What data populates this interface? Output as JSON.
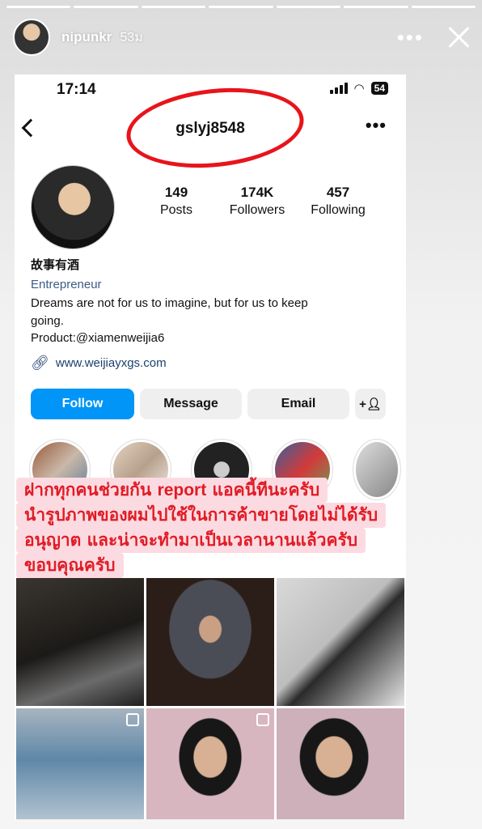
{
  "story": {
    "username": "nipunkr",
    "time": "53ม",
    "progress_count": 7
  },
  "status_bar": {
    "time": "17:14",
    "battery": "54"
  },
  "profile": {
    "username": "gslyj8548",
    "stats": [
      {
        "value": "149",
        "label": "Posts"
      },
      {
        "value": "174K",
        "label": "Followers"
      },
      {
        "value": "457",
        "label": "Following"
      }
    ],
    "name": "故事有酒",
    "category": "Entrepreneur",
    "bio_line1": "Dreams are not for us to imagine, but for us to keep",
    "bio_line2": "going.",
    "product": "Product:@xiamenweijia6",
    "link": "www.weijiayxgs.com"
  },
  "buttons": {
    "follow": "Follow",
    "message": "Message",
    "email": "Email"
  },
  "caption": {
    "line1_pre": "ฝากทุกคนช่วยกัน ",
    "line1_bold": "report",
    "line1_post": " แอคนี้ทีนะครับ",
    "line2": "นำรูปภาพของผมไปใช้ในการค้าขายโดยไม่ได้รับ",
    "line3": "อนุญาต และน่าจะทำมาเป็นเวลานานแล้วครับ",
    "line4": "ขอบคุณครับ"
  },
  "colors": {
    "follow_button": "#0095f6",
    "annotation_red": "#e8141b",
    "caption_bg": "#fbdbe1",
    "caption_text": "#e11b25"
  }
}
